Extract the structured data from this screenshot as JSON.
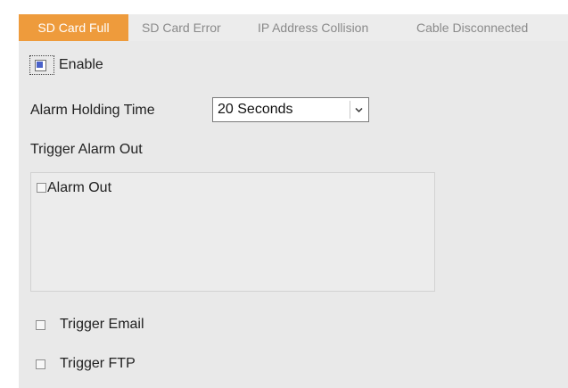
{
  "tabs": [
    {
      "label": "SD Card Full",
      "active": true
    },
    {
      "label": "SD Card Error",
      "active": false
    },
    {
      "label": "IP Address Collision",
      "active": false
    },
    {
      "label": "Cable Disconnected",
      "active": false
    }
  ],
  "enable": {
    "label": "Enable",
    "checked": true
  },
  "alarm_holding_time": {
    "label": "Alarm Holding Time",
    "value": "20 Seconds"
  },
  "trigger_alarm_out": {
    "heading": "Trigger Alarm Out",
    "items": [
      {
        "label": "Alarm Out",
        "checked": false
      }
    ]
  },
  "trigger_email": {
    "label": "Trigger Email",
    "checked": false
  },
  "trigger_ftp": {
    "label": "Trigger FTP",
    "checked": false
  },
  "colors": {
    "accent": "#ee9b3c",
    "panel": "#e9e9e9",
    "check": "#4a62c9"
  }
}
